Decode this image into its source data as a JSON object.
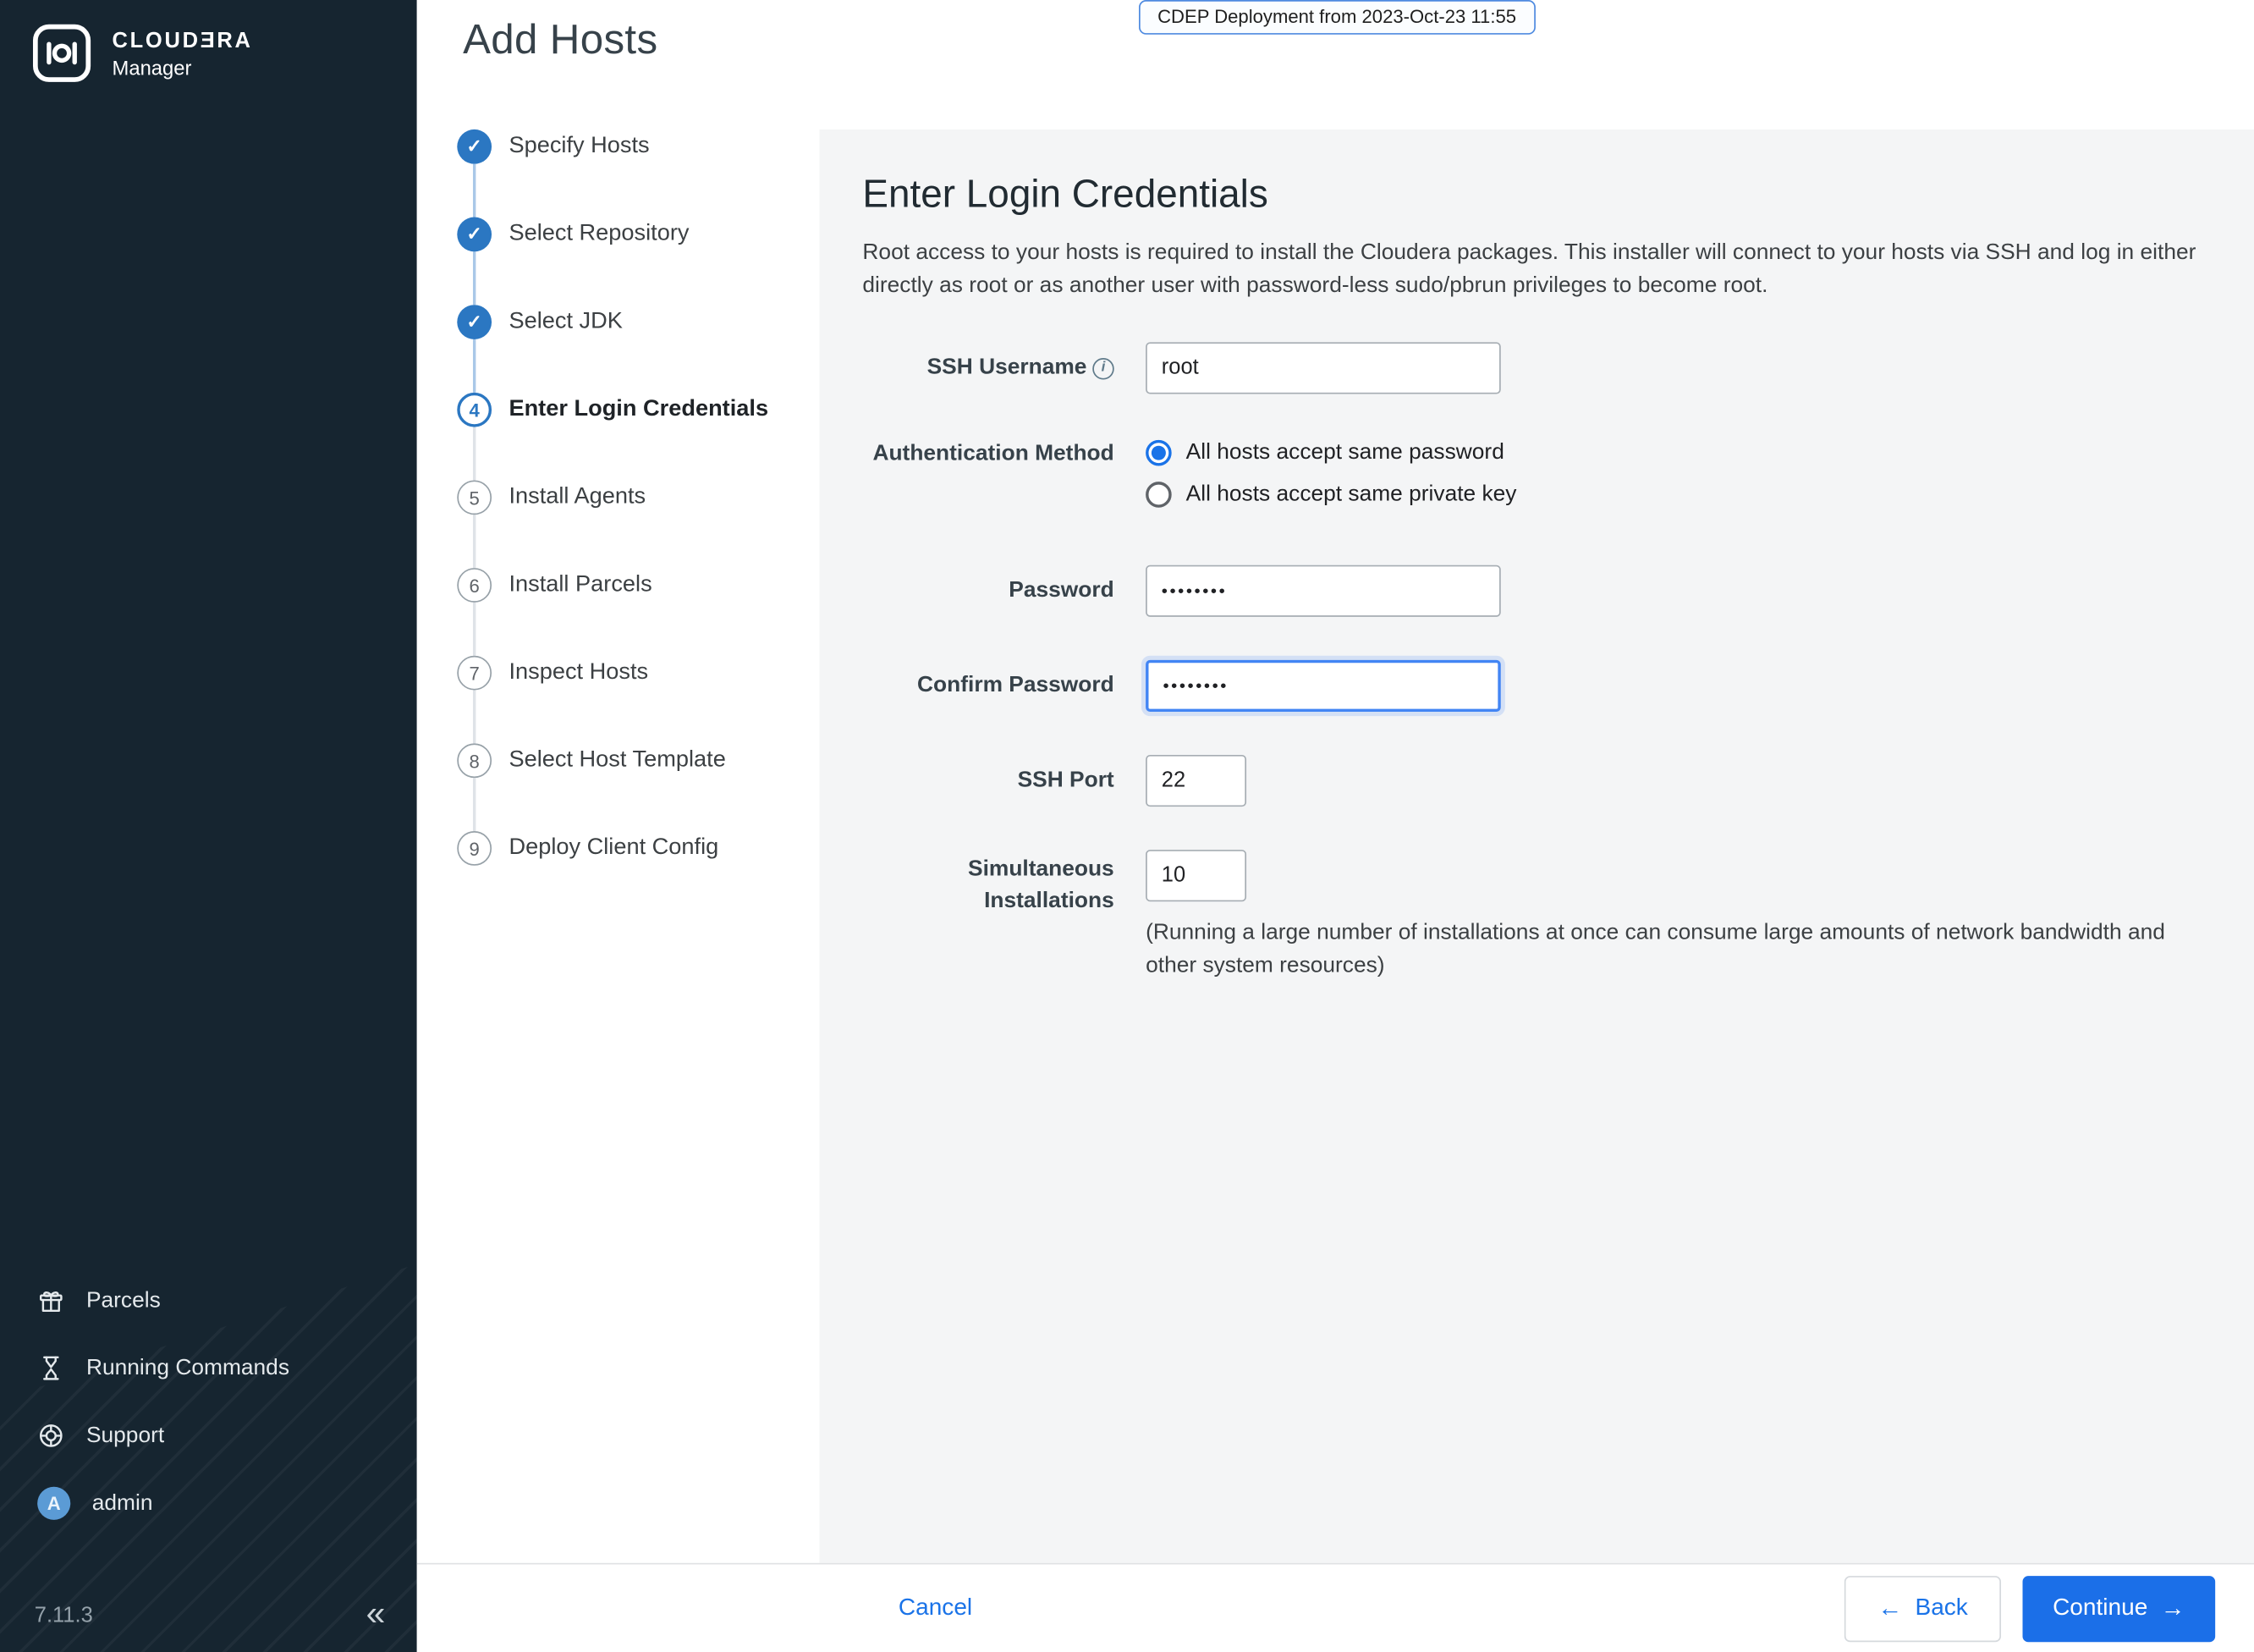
{
  "brand": {
    "name_top": "CLOUDƎRA",
    "name_bottom": "Manager",
    "version": "7.11.3"
  },
  "icons": {
    "check": "✓",
    "info": "i",
    "back_arrow": "←",
    "continue_arrow": "→",
    "collapse": "«",
    "avatar_letter": "A"
  },
  "sidebar": {
    "items": [
      {
        "label": "Parcels",
        "icon": "gift-icon"
      },
      {
        "label": "Running Commands",
        "icon": "hourglass-icon"
      },
      {
        "label": "Support",
        "icon": "life-ring-icon"
      },
      {
        "label": "admin",
        "icon": "avatar"
      }
    ]
  },
  "header": {
    "title": "Add Hosts",
    "deployment_badge": "CDEP Deployment from 2023-Oct-23 11:55"
  },
  "wizard": {
    "steps": [
      {
        "num": 1,
        "label": "Specify Hosts",
        "state": "done"
      },
      {
        "num": 2,
        "label": "Select Repository",
        "state": "done"
      },
      {
        "num": 3,
        "label": "Select JDK",
        "state": "done"
      },
      {
        "num": 4,
        "label": "Enter Login Credentials",
        "state": "current"
      },
      {
        "num": 5,
        "label": "Install Agents",
        "state": "todo"
      },
      {
        "num": 6,
        "label": "Install Parcels",
        "state": "todo"
      },
      {
        "num": 7,
        "label": "Inspect Hosts",
        "state": "todo"
      },
      {
        "num": 8,
        "label": "Select Host Template",
        "state": "todo"
      },
      {
        "num": 9,
        "label": "Deploy Client Config",
        "state": "todo"
      }
    ]
  },
  "form": {
    "title": "Enter Login Credentials",
    "intro": "Root access to your hosts is required to install the Cloudera packages. This installer will connect to your hosts via SSH and log in either directly as root or as another user with password-less sudo/pbrun privileges to become root.",
    "ssh_username": {
      "label": "SSH Username",
      "value": "root"
    },
    "auth_method": {
      "label": "Authentication Method",
      "options": [
        {
          "label": "All hosts accept same password",
          "selected": true
        },
        {
          "label": "All hosts accept same private key",
          "selected": false
        }
      ]
    },
    "password": {
      "label": "Password",
      "value": "••••••••"
    },
    "confirm_password": {
      "label": "Confirm Password",
      "value": "••••••••"
    },
    "ssh_port": {
      "label": "SSH Port",
      "value": "22"
    },
    "simultaneous": {
      "label": "Simultaneous Installations",
      "value": "10",
      "help": "(Running a large number of installations at once can consume large amounts of network bandwidth and other system resources)"
    }
  },
  "footer": {
    "cancel": "Cancel",
    "back": "Back",
    "continue": "Continue"
  },
  "colors": {
    "accent_blue": "#1a73e8",
    "step_blue": "#2b77c2",
    "sidebar_bg": "#162530"
  }
}
